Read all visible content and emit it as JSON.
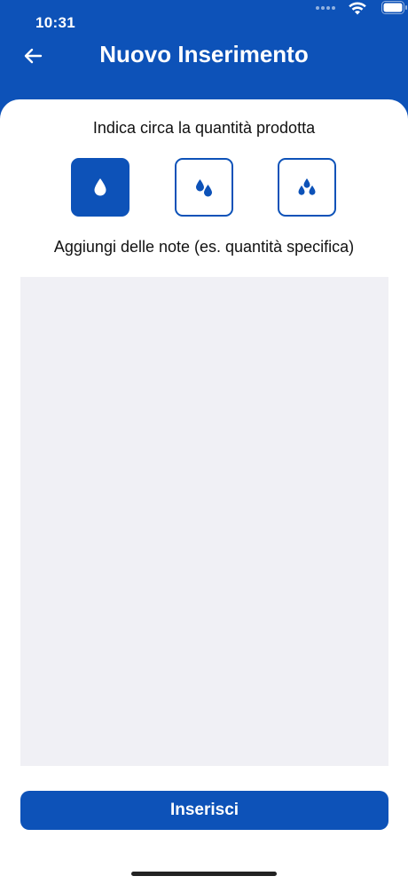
{
  "status_bar": {
    "time": "10:31"
  },
  "header": {
    "title": "Nuovo Inserimento"
  },
  "quantity": {
    "label": "Indica circa la quantità prodotta",
    "options": [
      {
        "icon": "single-drop-icon",
        "selected": true
      },
      {
        "icon": "two-drops-icon",
        "selected": false
      },
      {
        "icon": "three-drops-icon",
        "selected": false
      }
    ]
  },
  "notes": {
    "label": "Aggiungi delle note (es. quantità specifica)",
    "value": ""
  },
  "submit": {
    "label": "Inserisci"
  },
  "colors": {
    "primary": "#0d52b8",
    "notes_background": "#f0f0f5"
  }
}
